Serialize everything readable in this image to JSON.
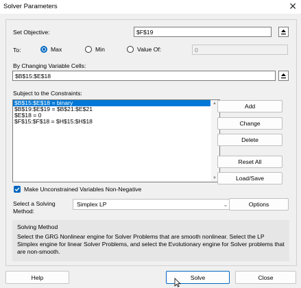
{
  "window": {
    "title": "Solver Parameters"
  },
  "objective": {
    "label": "Set Objective:",
    "value": "$F$19"
  },
  "to": {
    "label": "To:",
    "options": [
      {
        "label": "Max",
        "selected": true
      },
      {
        "label": "Min",
        "selected": false
      },
      {
        "label": "Value Of:",
        "selected": false
      }
    ],
    "value_of": "0"
  },
  "changing": {
    "label": "By Changing Variable Cells:",
    "value": "$B$15:$E$18"
  },
  "constraints": {
    "label": "Subject to the Constraints:",
    "items": [
      "$B$15:$E$18 = binary",
      "$B$19:$E$19 = $B$21:$E$21",
      "$E$18 = 0",
      "$F$15:$F$18 = $H$15:$H$18"
    ],
    "selected_index": 0
  },
  "side_buttons": {
    "add": "Add",
    "change": "Change",
    "delete": "Delete",
    "reset": "Reset All",
    "load_save": "Load/Save"
  },
  "nonneg": {
    "label": "Make Unconstrained Variables Non-Negative",
    "checked": true
  },
  "method": {
    "label_line1": "Select a Solving",
    "label_line2": "Method:",
    "selected": "Simplex LP",
    "options_button": "Options"
  },
  "method_info": {
    "title": "Solving Method",
    "text": "Select the GRG Nonlinear engine for Solver Problems that are smooth nonlinear. Select the LP Simplex engine for linear Solver Problems, and select the Evolutionary engine for Solver problems that are non-smooth."
  },
  "bottom": {
    "help": "Help",
    "solve": "Solve",
    "close": "Close"
  },
  "colors": {
    "accent": "#0067c0",
    "selection": "#0078d7",
    "panel": "#f0f0f0"
  }
}
